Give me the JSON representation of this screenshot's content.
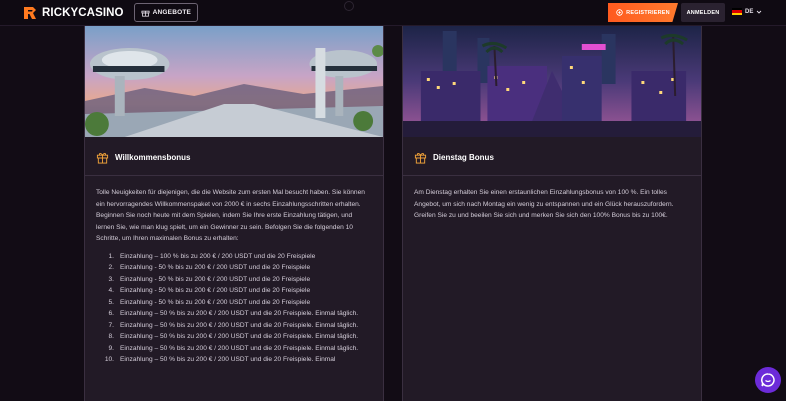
{
  "header": {
    "logo_text": "RICKYCASINO",
    "offers_label": "ANGEBOTE",
    "register_label": "REGISTRIEREN",
    "login_label": "ANMELDEN",
    "language": "DE"
  },
  "cards": {
    "welcome": {
      "title": "Willkommensbonus",
      "intro": "Tolle Neuigkeiten für diejenigen, die die Website zum ersten Mal besucht haben. Sie können ein hervorragendes Willkommenspaket von 2000 € in sechs Einzahlungsschritten erhalten. Beginnen Sie noch heute mit dem Spielen, indem Sie Ihre erste Einzahlung tätigen, und lernen Sie, wie man klug spielt, um ein Gewinner zu sein. Befolgen Sie die folgenden 10 Schritte, um Ihren maximalen Bonus zu erhalten:",
      "steps": [
        {
          "num": "1.",
          "text": "Einzahlung – 100 % bis zu 200 € / 200 USDT und die 20 Freispiele"
        },
        {
          "num": "2.",
          "text": "Einzahlung - 50 % bis zu 200 € / 200 USDT und die 20 Freispiele"
        },
        {
          "num": "3.",
          "text": "Einzahlung - 50 % bis zu 200 € / 200 USDT und die 20 Freispiele"
        },
        {
          "num": "4.",
          "text": "Einzahlung - 50 % bis zu 200 € / 200 USDT und die 20 Freispiele"
        },
        {
          "num": "5.",
          "text": "Einzahlung - 50 % bis zu 200 € / 200 USDT und die 20 Freispiele"
        },
        {
          "num": "6.",
          "text": "Einzahlung – 50 % bis zu 200 € / 200 USDT und die 20 Freispiele. Einmal täglich."
        },
        {
          "num": "7.",
          "text": "Einzahlung – 50 % bis zu 200 € / 200 USDT und die 20 Freispiele. Einmal täglich."
        },
        {
          "num": "8.",
          "text": "Einzahlung – 50 % bis zu 200 € / 200 USDT und die 20 Freispiele. Einmal täglich."
        },
        {
          "num": "9.",
          "text": "Einzahlung – 50 % bis zu 200 € / 200 USDT und die 20 Freispiele. Einmal täglich."
        },
        {
          "num": "10.",
          "text": "Einzahlung – 50 % bis zu 200 € / 200 USDT und die 20 Freispiele. Einmal"
        }
      ]
    },
    "tuesday": {
      "title": "Dienstag Bonus",
      "text": "Am Dienstag erhalten Sie einen erstaunlichen Einzahlungsbonus von 100 %. Ein tolles Angebot, um sich nach Montag ein wenig zu entspannen und ein Glück herauszufordern. Greifen Sie zu und beeilen Sie sich und merken Sie sich den 100% Bonus bis zu 100€."
    }
  },
  "colors": {
    "accent_orange": "#ff5a1f",
    "gift_gold": "#f2a33a",
    "chat_purple": "#6c2bd9",
    "background": "#120c15",
    "card_bg": "#221a26"
  }
}
